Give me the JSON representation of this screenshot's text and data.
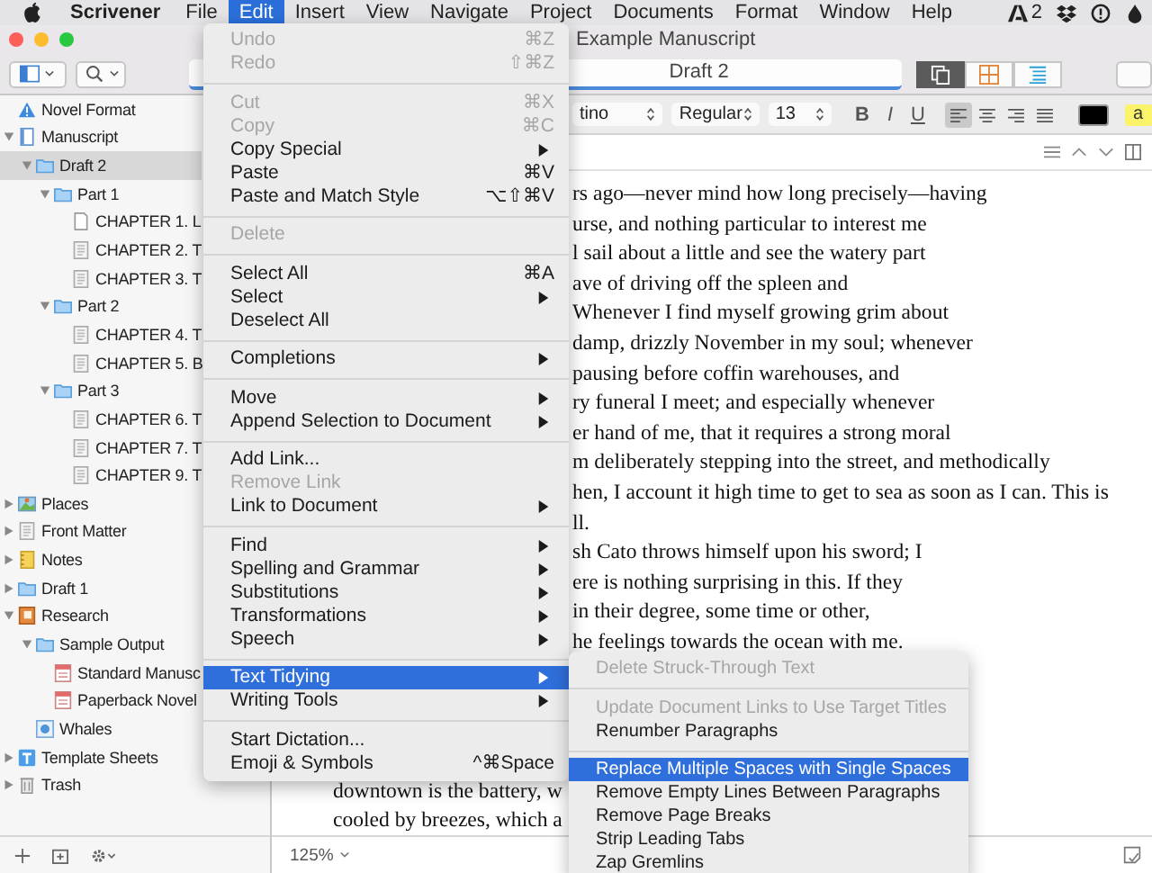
{
  "menu_bar": {
    "app": "Scrivener",
    "items": [
      {
        "label": "File",
        "selected": false
      },
      {
        "label": "Edit",
        "selected": true
      },
      {
        "label": "Insert",
        "selected": false
      },
      {
        "label": "View",
        "selected": false
      },
      {
        "label": "Navigate",
        "selected": false
      },
      {
        "label": "Project",
        "selected": false
      },
      {
        "label": "Documents",
        "selected": false
      },
      {
        "label": "Format",
        "selected": false
      },
      {
        "label": "Window",
        "selected": false
      },
      {
        "label": "Help",
        "selected": false
      }
    ],
    "status_count": "2"
  },
  "window": {
    "title": "Example Manuscript"
  },
  "toolbar": {
    "document_header": "Draft 2",
    "view_modes": [
      {
        "kind": "scrivenings",
        "selected": true
      },
      {
        "kind": "corkboard",
        "selected": false
      },
      {
        "kind": "outline",
        "selected": false
      }
    ]
  },
  "format_bar": {
    "font": "tino",
    "style": "Regular",
    "size": "13",
    "styles": [
      "B",
      "I",
      "U"
    ],
    "alignments": [
      {
        "kind": "left",
        "selected": true
      },
      {
        "kind": "center",
        "selected": false
      },
      {
        "kind": "right",
        "selected": false
      },
      {
        "kind": "justify",
        "selected": false
      }
    ],
    "highlight_label": "a"
  },
  "binder": {
    "items": [
      {
        "label": "Novel Format",
        "kind": "warning",
        "selected": false
      },
      {
        "label": "Manuscript",
        "kind": "manuscript",
        "selected": false,
        "expanded": true,
        "children": [
          {
            "label": "Draft 2",
            "kind": "folder",
            "selected": true,
            "expanded": true,
            "children": [
              {
                "label": "Part 1",
                "kind": "folder",
                "selected": false,
                "expanded": true,
                "children": [
                  {
                    "label": "CHAPTER 1. L",
                    "kind": "page",
                    "selected": false
                  },
                  {
                    "label": "CHAPTER 2. T",
                    "kind": "text",
                    "selected": false
                  },
                  {
                    "label": "CHAPTER 3. T",
                    "kind": "text",
                    "selected": false
                  }
                ]
              },
              {
                "label": "Part 2",
                "kind": "folder",
                "selected": false,
                "expanded": true,
                "children": [
                  {
                    "label": "CHAPTER 4. T",
                    "kind": "text",
                    "selected": false
                  },
                  {
                    "label": "CHAPTER 5. B",
                    "kind": "text",
                    "selected": false
                  }
                ]
              },
              {
                "label": "Part 3",
                "kind": "folder",
                "selected": false,
                "expanded": true,
                "children": [
                  {
                    "label": "CHAPTER 6. T",
                    "kind": "text",
                    "selected": false
                  },
                  {
                    "label": "CHAPTER 7. T",
                    "kind": "text",
                    "selected": false
                  },
                  {
                    "label": "CHAPTER 9. T",
                    "kind": "text",
                    "selected": false
                  }
                ]
              }
            ]
          }
        ]
      },
      {
        "label": "Places",
        "kind": "picture",
        "selected": false,
        "expanded": false
      },
      {
        "label": "Front Matter",
        "kind": "text",
        "selected": false,
        "expanded": false
      },
      {
        "label": "Notes",
        "kind": "notebook",
        "selected": false,
        "expanded": false
      },
      {
        "label": "Draft 1",
        "kind": "folder",
        "selected": false,
        "expanded": false
      },
      {
        "label": "Research",
        "kind": "book",
        "selected": false,
        "expanded": true,
        "children": [
          {
            "label": "Sample Output",
            "kind": "folder",
            "selected": false,
            "expanded": true,
            "children": [
              {
                "label": "Standard Manusc",
                "kind": "form",
                "selected": false
              },
              {
                "label": "Paperback Novel",
                "kind": "form",
                "selected": false
              }
            ]
          },
          {
            "label": "Whales",
            "kind": "image",
            "selected": false
          }
        ]
      },
      {
        "label": "Template Sheets",
        "kind": "templates",
        "selected": false,
        "expanded": false
      },
      {
        "label": "Trash",
        "kind": "trash",
        "selected": false,
        "expanded": false
      }
    ]
  },
  "editor": {
    "lines_beside_menu": [
      "rs ago—never mind how long precisely—having",
      "urse, and nothing particular to interest me",
      "l sail about a little and see the watery part",
      "ave of driving off the spleen and",
      "Whenever I find myself growing grim about",
      "damp, drizzly November in my soul; whenever",
      "pausing before coffin warehouses, and",
      "ry funeral I meet; and especially whenever",
      "er hand of me, that it requires a strong moral",
      "m deliberately stepping into the street, and methodically",
      "hen, I account it high time to get to sea as soon as I can. This is",
      "ll.",
      "sh Cato throws himself upon his sword; I",
      "ere is nothing surprising in this. If they",
      "in their degree, some time or other,",
      "he feelings towards the ocean with me."
    ],
    "lines_below_menu": [
      "downtown is the battery, w",
      "cooled by breezes, which a"
    ],
    "zoom": "125%"
  },
  "edit_menu": {
    "items": [
      {
        "kind": "item",
        "label": "Undo",
        "shortcut": "⌘Z",
        "disabled": true,
        "selected": false
      },
      {
        "kind": "item",
        "label": "Redo",
        "shortcut": "⇧⌘Z",
        "disabled": true,
        "selected": false
      },
      {
        "kind": "separator"
      },
      {
        "kind": "item",
        "label": "Cut",
        "shortcut": "⌘X",
        "disabled": true,
        "selected": false
      },
      {
        "kind": "item",
        "label": "Copy",
        "shortcut": "⌘C",
        "disabled": true,
        "selected": false
      },
      {
        "kind": "item",
        "label": "Copy Special",
        "submenu": true,
        "disabled": false,
        "selected": false
      },
      {
        "kind": "item",
        "label": "Paste",
        "shortcut": "⌘V",
        "disabled": false,
        "selected": false
      },
      {
        "kind": "item",
        "label": "Paste and Match Style",
        "shortcut": "⌥⇧⌘V",
        "disabled": false,
        "selected": false
      },
      {
        "kind": "separator"
      },
      {
        "kind": "item",
        "label": "Delete",
        "disabled": true,
        "selected": false
      },
      {
        "kind": "separator"
      },
      {
        "kind": "item",
        "label": "Select All",
        "shortcut": "⌘A",
        "disabled": false,
        "selected": false
      },
      {
        "kind": "item",
        "label": "Select",
        "submenu": true,
        "disabled": false,
        "selected": false
      },
      {
        "kind": "item",
        "label": "Deselect All",
        "disabled": false,
        "selected": false
      },
      {
        "kind": "separator"
      },
      {
        "kind": "item",
        "label": "Completions",
        "submenu": true,
        "disabled": false,
        "selected": false
      },
      {
        "kind": "separator"
      },
      {
        "kind": "item",
        "label": "Move",
        "submenu": true,
        "disabled": false,
        "selected": false
      },
      {
        "kind": "item",
        "label": "Append Selection to Document",
        "submenu": true,
        "disabled": false,
        "selected": false
      },
      {
        "kind": "separator"
      },
      {
        "kind": "item",
        "label": "Add Link...",
        "disabled": false,
        "selected": false
      },
      {
        "kind": "item",
        "label": "Remove Link",
        "disabled": true,
        "selected": false
      },
      {
        "kind": "item",
        "label": "Link to Document",
        "submenu": true,
        "disabled": false,
        "selected": false
      },
      {
        "kind": "separator"
      },
      {
        "kind": "item",
        "label": "Find",
        "submenu": true,
        "disabled": false,
        "selected": false
      },
      {
        "kind": "item",
        "label": "Spelling and Grammar",
        "submenu": true,
        "disabled": false,
        "selected": false
      },
      {
        "kind": "item",
        "label": "Substitutions",
        "submenu": true,
        "disabled": false,
        "selected": false
      },
      {
        "kind": "item",
        "label": "Transformations",
        "submenu": true,
        "disabled": false,
        "selected": false
      },
      {
        "kind": "item",
        "label": "Speech",
        "submenu": true,
        "disabled": false,
        "selected": false
      },
      {
        "kind": "separator"
      },
      {
        "kind": "item",
        "label": "Text Tidying",
        "submenu": true,
        "disabled": false,
        "selected": true
      },
      {
        "kind": "item",
        "label": "Writing Tools",
        "submenu": true,
        "disabled": false,
        "selected": false
      },
      {
        "kind": "separator"
      },
      {
        "kind": "item",
        "label": "Start Dictation...",
        "disabled": false,
        "selected": false
      },
      {
        "kind": "item",
        "label": "Emoji & Symbols",
        "shortcut": "^⌘Space",
        "disabled": false,
        "selected": false
      }
    ]
  },
  "text_tidying_menu": {
    "items": [
      {
        "kind": "item",
        "label": "Delete Struck-Through Text",
        "disabled": true,
        "selected": false
      },
      {
        "kind": "separator"
      },
      {
        "kind": "item",
        "label": "Update Document Links to Use Target Titles",
        "disabled": true,
        "selected": false
      },
      {
        "kind": "item",
        "label": "Renumber Paragraphs",
        "disabled": false,
        "selected": false
      },
      {
        "kind": "separator"
      },
      {
        "kind": "item",
        "label": "Replace Multiple Spaces with Single Spaces",
        "disabled": false,
        "selected": true
      },
      {
        "kind": "item",
        "label": "Remove Empty Lines Between Paragraphs",
        "disabled": false,
        "selected": false
      },
      {
        "kind": "item",
        "label": "Remove Page Breaks",
        "disabled": false,
        "selected": false
      },
      {
        "kind": "item",
        "label": "Strip Leading Tabs",
        "disabled": false,
        "selected": false
      },
      {
        "kind": "item",
        "label": "Zap Gremlins",
        "disabled": false,
        "selected": false
      }
    ]
  }
}
